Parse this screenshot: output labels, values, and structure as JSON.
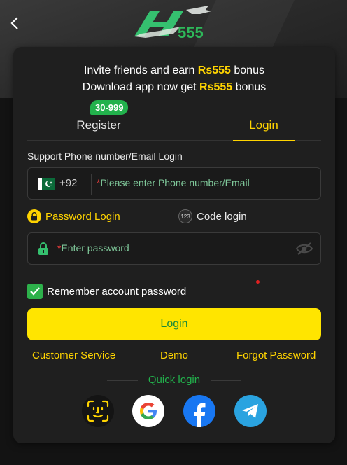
{
  "header": {
    "back_icon": "chevron-left-icon",
    "logo_text": "555"
  },
  "card": {
    "invite_line1_prefix": "Invite friends and earn ",
    "invite_line1_amount": "Rs555",
    "invite_line1_suffix": " bonus",
    "invite_line2_prefix": "Download app now get ",
    "invite_line2_amount": "Rs555",
    "invite_line2_suffix": " bonus"
  },
  "tabs": {
    "register": "Register",
    "login": "Login",
    "badge": "30-999",
    "active": "login"
  },
  "form": {
    "support_label": "Support Phone number/Email Login",
    "country_code": "+92",
    "required_mark": "*",
    "phone_placeholder": "Please enter Phone number/Email",
    "password_login_label": "Password Login",
    "code_login_label": "Code login",
    "code_icon_text": "123",
    "password_placeholder": "Enter password",
    "remember_label": "Remember account password",
    "remember_checked": true,
    "login_button": "Login"
  },
  "links": {
    "customer_service": "Customer Service",
    "demo": "Demo",
    "forgot_password": "Forgot Password"
  },
  "quick_login": {
    "label": "Quick login",
    "providers": [
      "face-id-icon",
      "google-icon",
      "facebook-icon",
      "telegram-icon"
    ]
  },
  "colors": {
    "accent_yellow": "#ffd400",
    "button_yellow": "#ffe500",
    "green": "#22b14c",
    "card_bg": "#1f1f1f"
  }
}
